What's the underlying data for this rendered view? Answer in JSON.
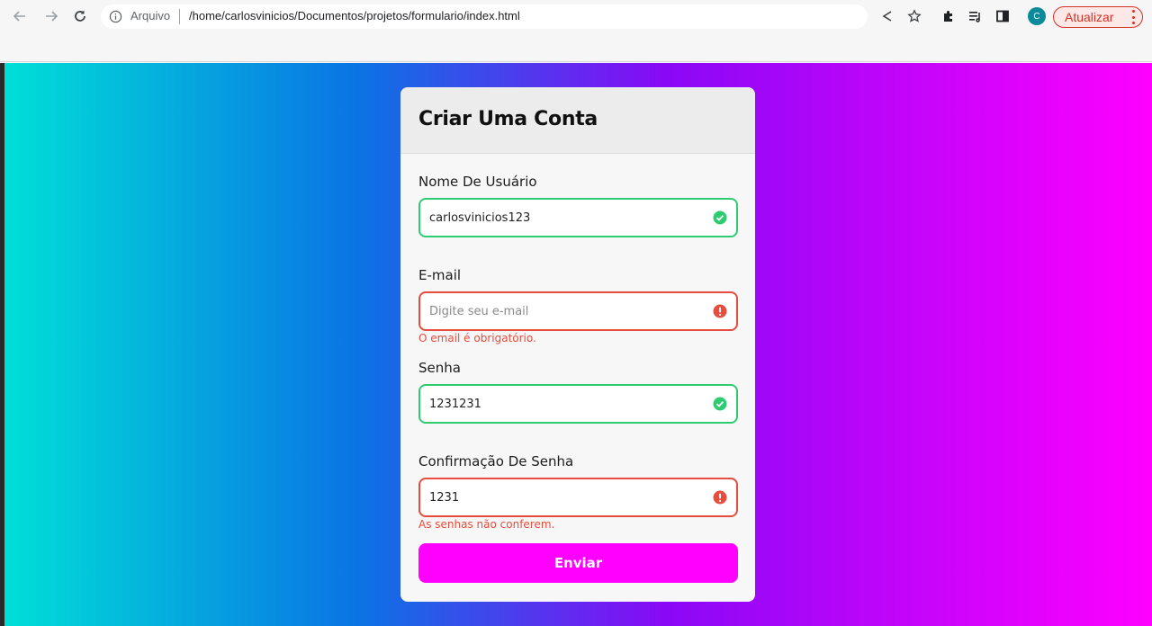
{
  "browser": {
    "address_security": "Arquivo",
    "address_url": "/home/carlosvinicios/Documentos/projetos/formulario/index.html",
    "profile_initial": "C",
    "update_label": "Atualizar",
    "icons": {
      "back": "arrow-left-icon",
      "forward": "arrow-right-icon",
      "reload": "reload-icon",
      "info": "info-icon",
      "share": "share-icon",
      "bookmark": "star-icon",
      "extensions": "puzzle-icon",
      "reading_list": "reading-list-icon",
      "side_panel": "side-panel-icon",
      "menu": "kebab-menu-icon"
    }
  },
  "colors": {
    "gradient": [
      "#00e0d8",
      "#0a74e4",
      "#8a08f6",
      "#ff00ff"
    ],
    "success": "#2ecc71",
    "error": "#e74c3c",
    "button": "#ff00ff"
  },
  "form": {
    "title": "Criar Uma Conta",
    "fields": [
      {
        "label": "Nome De Usuário",
        "value": "carlosvinicios123",
        "placeholder": "",
        "status": "success",
        "error": ""
      },
      {
        "label": "E-mail",
        "value": "",
        "placeholder": "Digite seu e-mail",
        "status": "error",
        "error": "O email é obrigatório."
      },
      {
        "label": "Senha",
        "value": "1231231",
        "placeholder": "",
        "status": "success",
        "error": ""
      },
      {
        "label": "Confirmação De Senha",
        "value": "1231",
        "placeholder": "",
        "status": "error",
        "error": "As senhas não conferem."
      }
    ],
    "submit_label": "Enviar"
  }
}
